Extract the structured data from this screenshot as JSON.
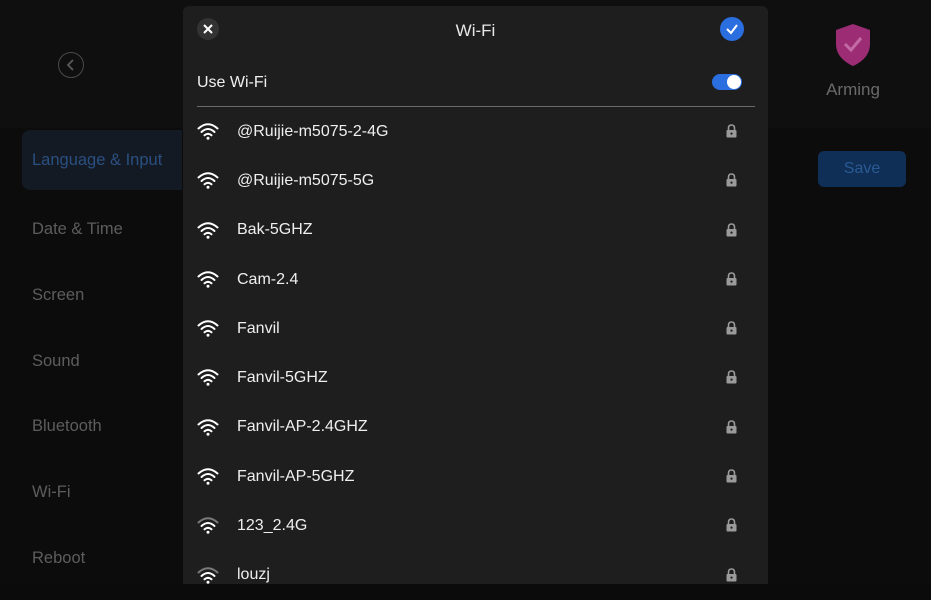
{
  "header": {
    "back_icon": "chevron-left-icon",
    "arming_label": "Arming",
    "arming_icon": "shield-check-icon"
  },
  "sidebar": {
    "items": [
      {
        "label": "Language & Input",
        "active": true
      },
      {
        "label": "Date & Time",
        "active": false
      },
      {
        "label": "Screen",
        "active": false
      },
      {
        "label": "Sound",
        "active": false
      },
      {
        "label": "Bluetooth",
        "active": false
      },
      {
        "label": "Wi-Fi",
        "active": false
      },
      {
        "label": "Reboot",
        "active": false
      }
    ]
  },
  "main": {
    "save_label": "Save"
  },
  "wifi_sheet": {
    "title": "Wi-Fi",
    "close_icon": "close-icon",
    "confirm_icon": "check-icon",
    "use_wifi_label": "Use Wi-Fi",
    "use_wifi_enabled": true,
    "networks": [
      {
        "ssid": "@Ruijie-m5075-2-4G",
        "locked": true,
        "signal": "strong"
      },
      {
        "ssid": "@Ruijie-m5075-5G",
        "locked": true,
        "signal": "strong"
      },
      {
        "ssid": "Bak-5GHZ",
        "locked": true,
        "signal": "strong"
      },
      {
        "ssid": "Cam-2.4",
        "locked": true,
        "signal": "strong"
      },
      {
        "ssid": "Fanvil",
        "locked": true,
        "signal": "strong"
      },
      {
        "ssid": "Fanvil-5GHZ",
        "locked": true,
        "signal": "strong"
      },
      {
        "ssid": "Fanvil-AP-2.4GHZ",
        "locked": true,
        "signal": "strong"
      },
      {
        "ssid": "Fanvil-AP-5GHZ",
        "locked": true,
        "signal": "strong"
      },
      {
        "ssid": "123_2.4G",
        "locked": true,
        "signal": "weak"
      },
      {
        "ssid": "louzj",
        "locked": true,
        "signal": "weak"
      }
    ]
  },
  "colors": {
    "accent": "#2b6ee0",
    "sheet_bg": "#1e1e1e",
    "arming_shield": "#9c2c74"
  }
}
